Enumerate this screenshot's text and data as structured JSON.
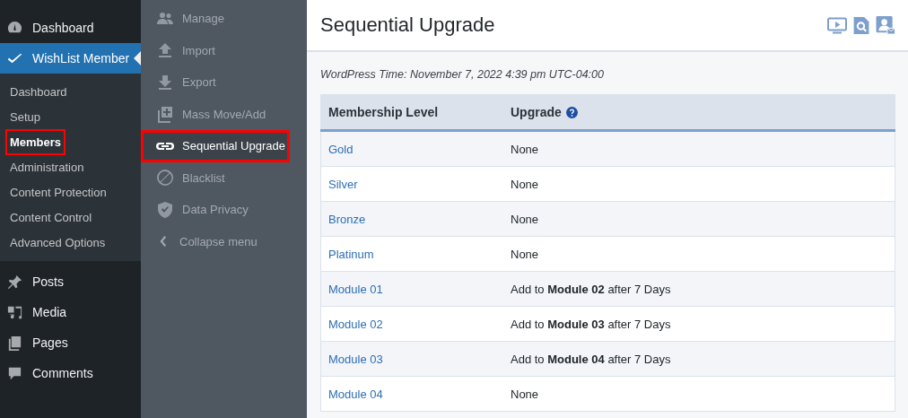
{
  "menu": [
    {
      "label": "Dashboard",
      "current": false
    },
    {
      "label": "WishList Member",
      "current": true
    }
  ],
  "submenu": [
    {
      "label": "Dashboard",
      "selected": false,
      "highlighted": false
    },
    {
      "label": "Setup",
      "selected": false,
      "highlighted": false
    },
    {
      "label": "Members",
      "selected": true,
      "highlighted": true
    },
    {
      "label": "Administration",
      "selected": false,
      "highlighted": false
    },
    {
      "label": "Content Protection",
      "selected": false,
      "highlighted": false
    },
    {
      "label": "Content Control",
      "selected": false,
      "highlighted": false
    },
    {
      "label": "Advanced Options",
      "selected": false,
      "highlighted": false
    }
  ],
  "menu_lower": [
    {
      "label": "Posts"
    },
    {
      "label": "Media"
    },
    {
      "label": "Pages"
    },
    {
      "label": "Comments"
    }
  ],
  "flyout": [
    {
      "label": "Manage",
      "selected": false,
      "highlighted": false
    },
    {
      "label": "Import",
      "selected": false,
      "highlighted": false
    },
    {
      "label": "Export",
      "selected": false,
      "highlighted": false
    },
    {
      "label": "Mass Move/Add",
      "selected": false,
      "highlighted": false
    },
    {
      "label": "Sequential Upgrade",
      "selected": true,
      "highlighted": true
    },
    {
      "label": "Blacklist",
      "selected": false,
      "highlighted": false
    },
    {
      "label": "Data Privacy",
      "selected": false,
      "highlighted": false
    }
  ],
  "collapse": {
    "label": "Collapse menu"
  },
  "page": {
    "title": "Sequential Upgrade",
    "time": "WordPress Time: November 7, 2022 4:39 pm UTC-04:00"
  },
  "table": {
    "columns": [
      "Membership Level",
      "Upgrade"
    ],
    "rows": [
      {
        "level": "Gold",
        "upgrade": "None"
      },
      {
        "level": "Silver",
        "upgrade": "None"
      },
      {
        "level": "Bronze",
        "upgrade": "None"
      },
      {
        "level": "Platinum",
        "upgrade": "None"
      },
      {
        "level": "Module 01",
        "upgrade": "Add to **Module 02** after 7 Days"
      },
      {
        "level": "Module 02",
        "upgrade": "Add to **Module 03** after 7 Days"
      },
      {
        "level": "Module 03",
        "upgrade": "Add to **Module 04** after 7 Days"
      },
      {
        "level": "Module 04",
        "upgrade": "None"
      }
    ]
  }
}
